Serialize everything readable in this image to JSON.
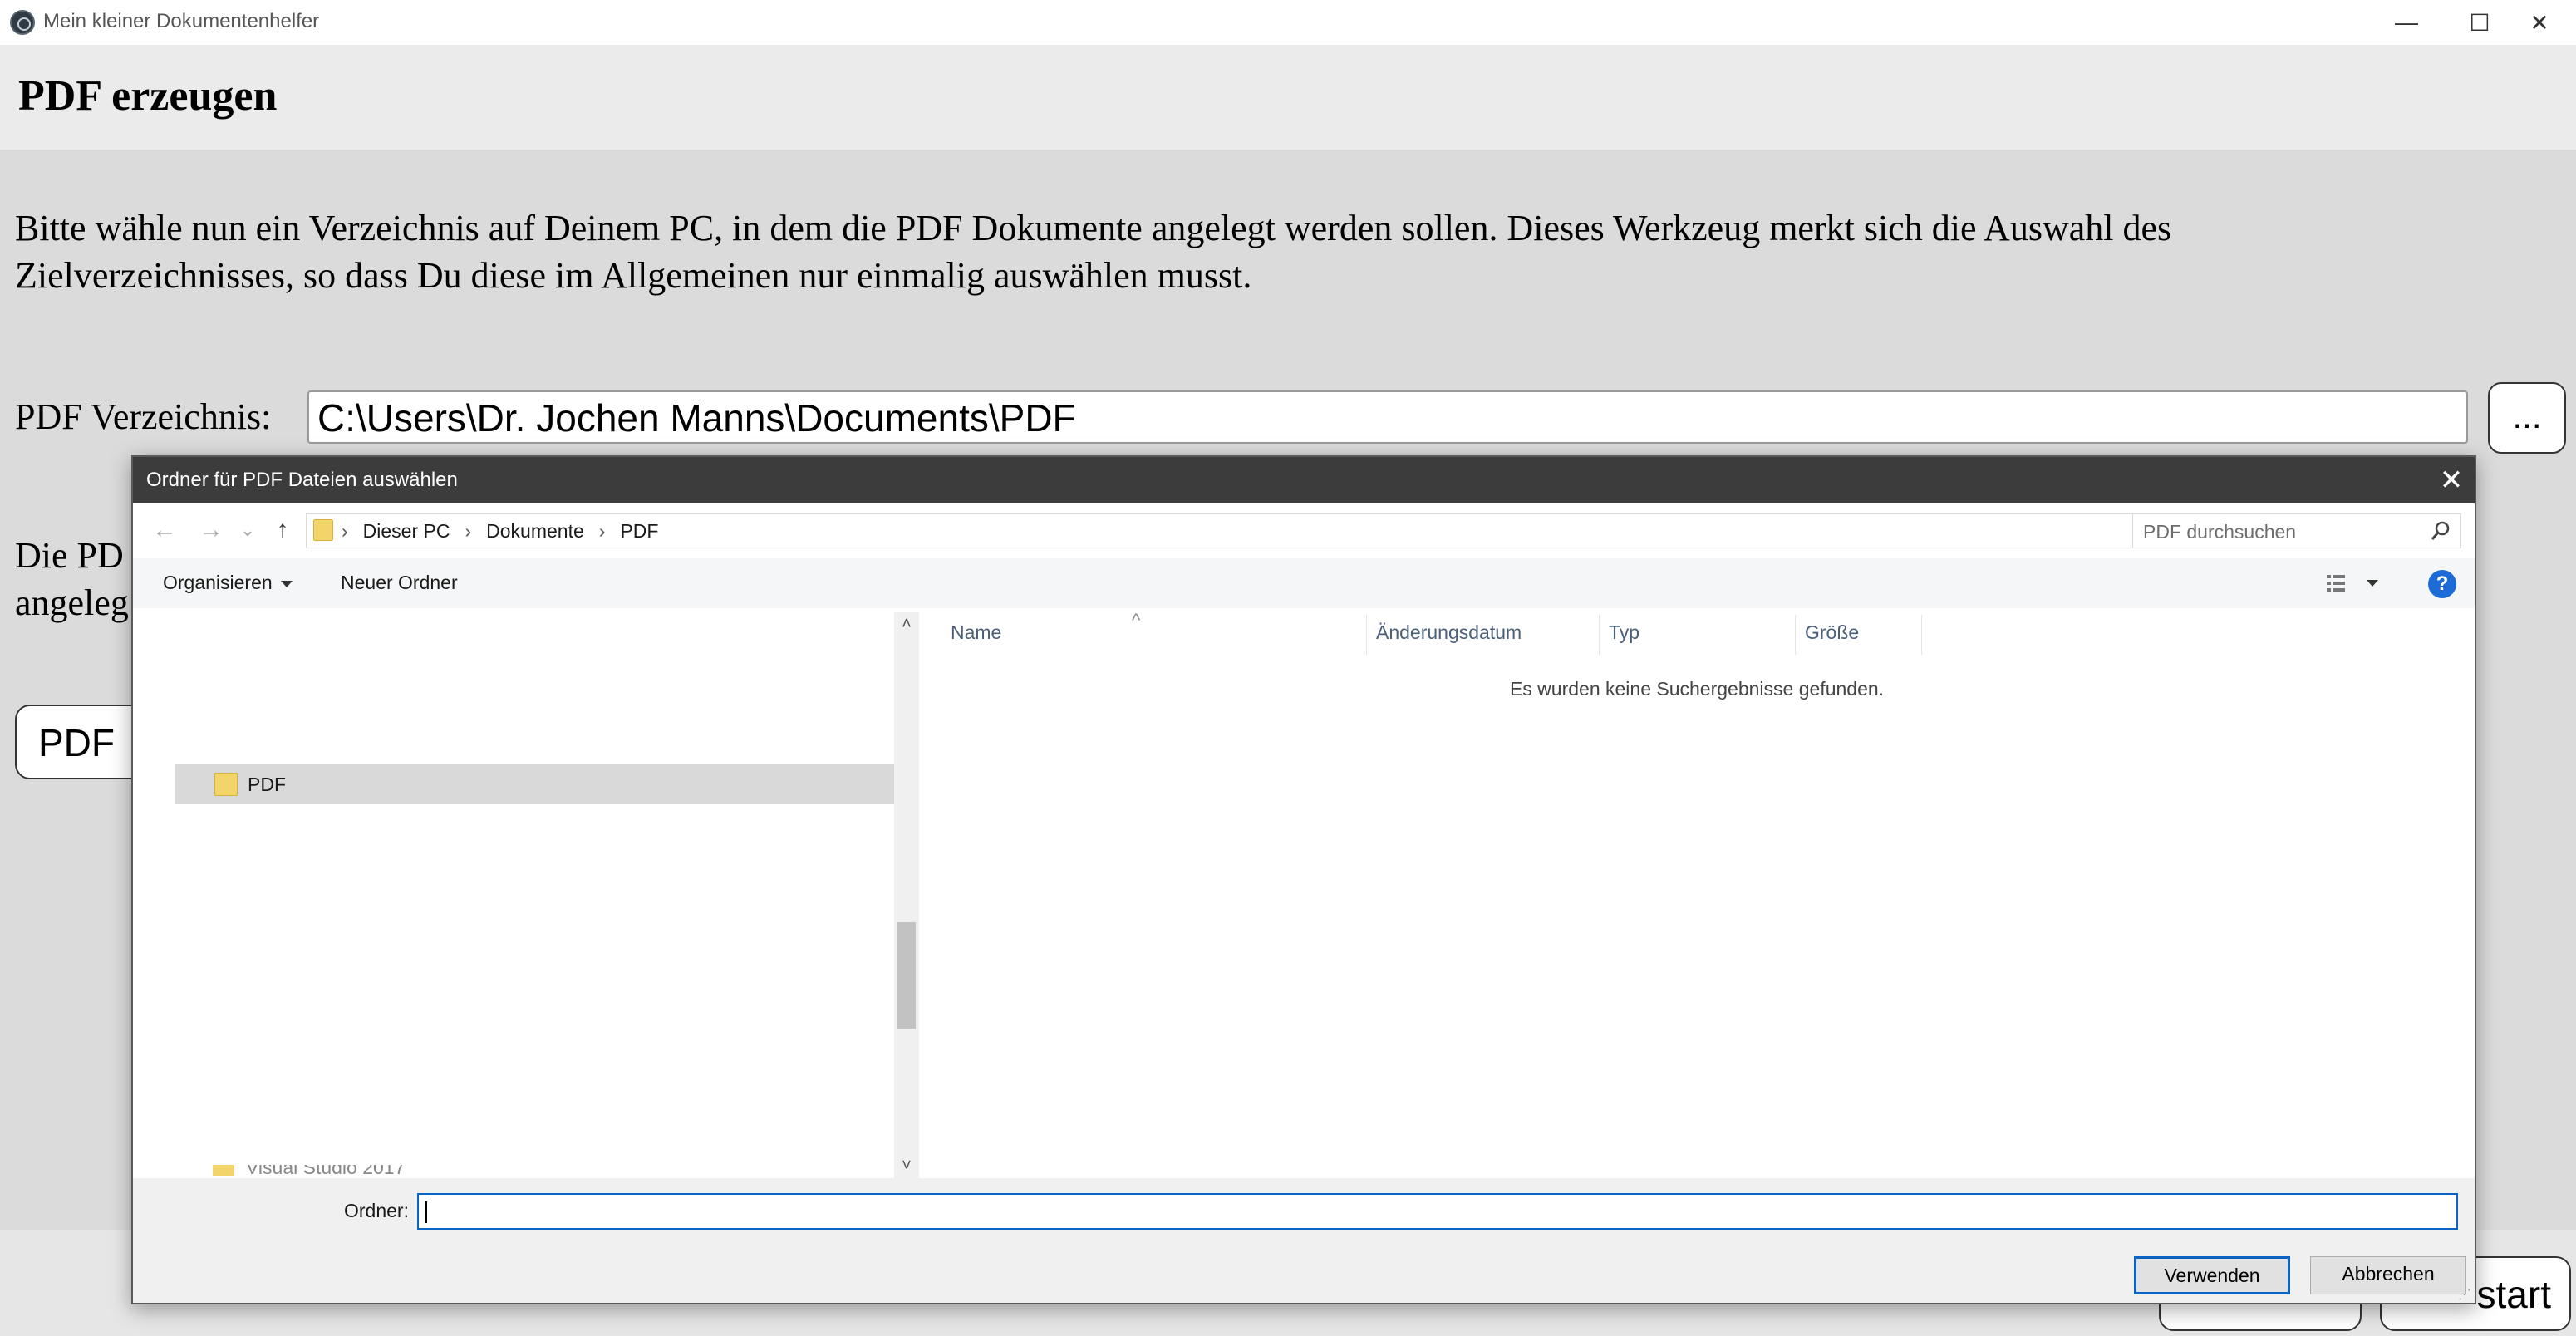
{
  "window": {
    "title": "Mein kleiner Dokumentenhelfer",
    "controls": {
      "minimize": "—",
      "maximize": "☐",
      "close": "✕"
    }
  },
  "page": {
    "title": "PDF erzeugen",
    "intro": "Bitte wähle nun ein Verzeichnis auf Deinem PC, in dem die PDF Dokumente angelegt werden sollen. Dieses Werkzeug merkt sich die Auswahl des Zielverzeichnisses, so dass Du diese im Allgemeinen nur einmalig auswählen musst.",
    "dir_label": "PDF Verzeichnis:",
    "dir_value": "C:\\Users\\Dr. Jochen Manns\\Documents\\PDF",
    "browse_label": "...",
    "info_line1_partial": "Die PD",
    "info_line2_partial": "angeleg",
    "pdf_button_partial": "PDF",
    "start_button_partial": "start"
  },
  "dialog": {
    "title": "Ordner für PDF Dateien auswählen",
    "close": "✕",
    "nav": {
      "back": "←",
      "forward": "→",
      "recent": "⌄",
      "up": "↑"
    },
    "breadcrumb": [
      "Dieser PC",
      "Dokumente",
      "PDF"
    ],
    "breadcrumb_sep": "›",
    "addr_dropdown": "⌄",
    "refresh": "↻",
    "search_placeholder": "PDF durchsuchen",
    "toolbar": {
      "organize": "Organisieren",
      "new_folder": "Neuer Ordner",
      "help": "?"
    },
    "tree": {
      "selected_item": "PDF",
      "peek_item": "Visual Studio 2017"
    },
    "scroll": {
      "up": "˄",
      "down": "˅"
    },
    "columns": [
      "Name",
      "Änderungsdatum",
      "Typ",
      "Größe"
    ],
    "sort_caret": "^",
    "empty_message": "Es wurden keine Suchergebnisse gefunden.",
    "folder_label": "Ordner:",
    "folder_value": "",
    "use_button": "Verwenden",
    "cancel_button": "Abbrechen",
    "grip": "⋰"
  }
}
